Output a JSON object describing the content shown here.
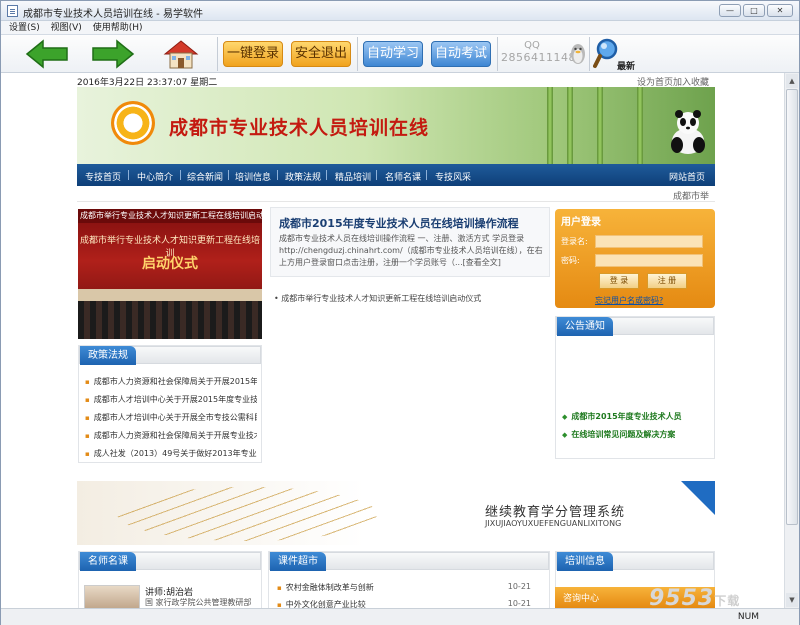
{
  "window": {
    "title": "成都市专业技术人员培训在线 - 易学软件",
    "controls": [
      "—",
      "□",
      "✕"
    ]
  },
  "menu": [
    {
      "label": "设置(S)"
    },
    {
      "label": "视图(V)"
    },
    {
      "label": "使用帮助(H)"
    }
  ],
  "toolbar": {
    "login": "一键登录",
    "logout": "安全退出",
    "auto_study": "自动学习",
    "auto_exam": "自动考试",
    "qq_label": "QQ",
    "qq_number": "2856411148",
    "latest": "最新"
  },
  "page": {
    "date": "2016年3月22日 23:37:07 星期二",
    "top_links": "设为首页加入收藏",
    "banner_title": "成都市专业技术人员培训在线",
    "nav": [
      "专技首页",
      "中心简介",
      "综合新闻",
      "培训信息",
      "政策法规",
      "精品培训",
      "名师名课",
      "专技风采",
      "网站首页"
    ],
    "subnav_right": "成都市举",
    "photo_marquee": "成都市举行专业技术人才知识更新工程在线培训启动仪",
    "photo_banner": "成都市举行专业技术人才知识更新工程在线培训",
    "photo_ceremony": "启动仪式",
    "featured_title": "成都市2015年度专业技术人员在线培训操作流程",
    "featured_body": "成都市专业技术人员在线培训操作流程 一、注册、激活方式 学员登录http://chengduzj.chinahrt.com/（成都市专业技术人员培训在线），在右上方用户登录窗口点击注册，注册一个学员账号（...[查看全文]",
    "bullet_news": "成都市举行专业技术人才知识更新工程在线培训启动仪式",
    "policy": {
      "header": "政策法规",
      "items": [
        {
          "text": "成都市人力资源和社会保障局关于开展2015年"
        },
        {
          "text": "成都市人才培训中心关于开展2015年度专业技"
        },
        {
          "text": "成都市人才培训中心关于开展全市专技公需科目"
        },
        {
          "text": "成都市人力资源和社会保障局关于开展专业技术"
        },
        {
          "text": "成人社发（2013）49号关于做好2013年专业"
        }
      ]
    },
    "login": {
      "header": "用户登录",
      "username_label": "登录名:",
      "password_label": "密码:",
      "login_btn": "登 录",
      "register_btn": "注 册",
      "forgot": "忘记用户名或密码?"
    },
    "notice": {
      "header": "公告通知",
      "items": [
        {
          "text": "成都市2015年度专业技术人员"
        },
        {
          "text": "在线培训常见问题及解决方案"
        }
      ]
    },
    "ad": {
      "title": "继续教育学分管理系统",
      "subtitle": "JIXUJIAOYUXUEFENGUANLIXITONG"
    },
    "teachers": {
      "header": "名师名课",
      "name": "讲师:胡治岩",
      "desc": "国 家行政学院公共管理教研部"
    },
    "courses": {
      "header": "课件超市",
      "items": [
        {
          "text": "农村金融体制改革与创新",
          "date": "10-21"
        },
        {
          "text": "中外文化创意产业比较",
          "date": "10-21"
        }
      ]
    },
    "training": {
      "header": "培训信息",
      "consult": "咨询中心"
    }
  },
  "status": {
    "num": "NUM"
  },
  "watermark": {
    "main": "9553",
    "small": "下载"
  }
}
